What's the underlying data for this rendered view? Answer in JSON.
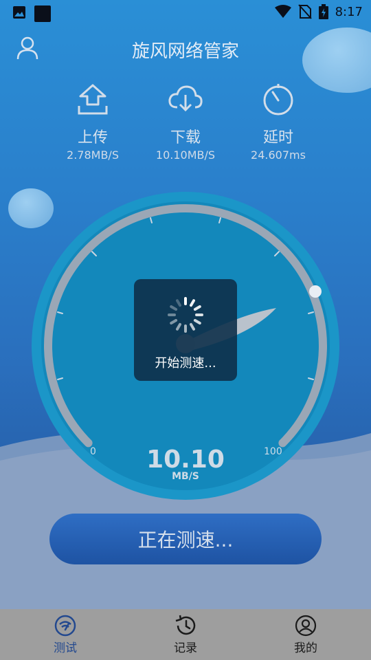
{
  "status_bar": {
    "time": "8:17",
    "icons": [
      "image-icon",
      "app-icon",
      "wifi-icon",
      "no-sim-icon",
      "battery-icon"
    ]
  },
  "header": {
    "title": "旋风网络管家",
    "user_icon": "user-icon"
  },
  "stats": {
    "upload": {
      "label": "上传",
      "value": "2.78MB/S",
      "icon": "upload-icon"
    },
    "download": {
      "label": "下载",
      "value": "10.10MB/S",
      "icon": "download-icon"
    },
    "latency": {
      "label": "延时",
      "value": "24.607ms",
      "icon": "timer-icon"
    }
  },
  "gauge": {
    "value": "10.10",
    "unit": "MB/S",
    "min_label": "0",
    "max_label": "100"
  },
  "toast": {
    "text": "开始测速..."
  },
  "action_button": {
    "label": "正在测速..."
  },
  "bottom_nav": {
    "items": [
      {
        "label": "测试",
        "icon": "speedometer-icon",
        "active": true
      },
      {
        "label": "记录",
        "icon": "history-icon",
        "active": false
      },
      {
        "label": "我的",
        "icon": "profile-icon",
        "active": false
      }
    ]
  },
  "colors": {
    "background": "#2a7fcb",
    "gauge_face": "#1888bd",
    "button": "#2461b4",
    "nav_bar": "#9e9e9e",
    "nav_active": "#23498f"
  }
}
